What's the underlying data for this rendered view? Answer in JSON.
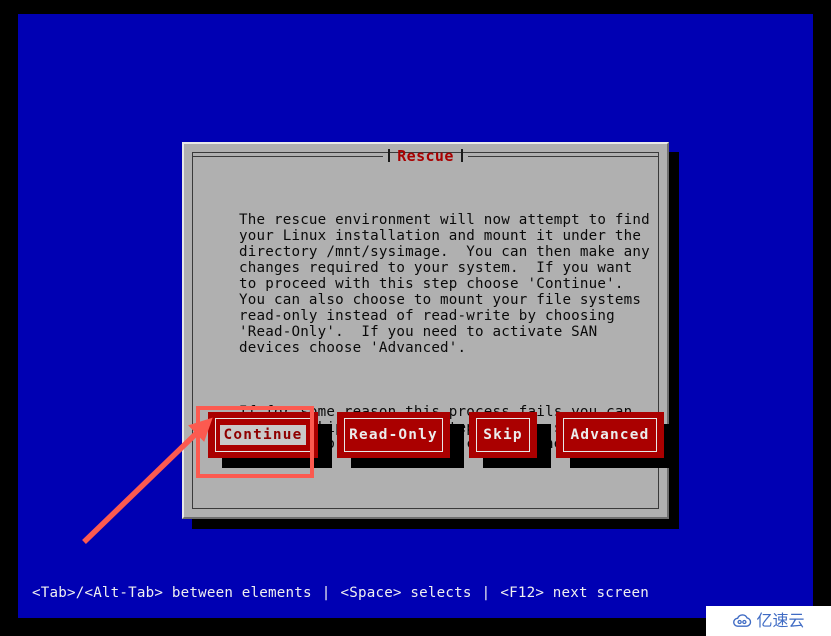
{
  "screen": {
    "background_color": "#0000b3",
    "frame_color": "#000000"
  },
  "dialog": {
    "title": "Rescue",
    "title_color": "#a80000",
    "background_color": "#b0b0b0",
    "paragraphs": [
      "The rescue environment will now attempt to find\nyour Linux installation and mount it under the\ndirectory /mnt/sysimage.  You can then make any\nchanges required to your system.  If you want\nto proceed with this step choose 'Continue'.\nYou can also choose to mount your file systems\nread-only instead of read-write by choosing\n'Read-Only'.  If you need to activate SAN\ndevices choose 'Advanced'.",
      "If for some reason this process fails you can\nchoose 'Skip' and this step will be skipped and\nyou will go directly to a command shell."
    ],
    "buttons": [
      {
        "label": "Continue",
        "selected": true
      },
      {
        "label": "Read-Only",
        "selected": false
      },
      {
        "label": "Skip",
        "selected": false
      },
      {
        "label": "Advanced",
        "selected": false
      }
    ],
    "button_color": "#aa0000",
    "button_text_color": "#ececec",
    "selected_label_bg": "#c9c9c9",
    "selected_label_color": "#8e0000"
  },
  "annotations": {
    "highlight_color": "#fc5a50",
    "highlight_target": "Continue",
    "arrow_color": "#fc5a50"
  },
  "statusbar": {
    "hint_tab": "<Tab>/<Alt-Tab> between elements",
    "separator_1": "|",
    "hint_space": "<Space> selects",
    "separator_2": "|",
    "hint_f12": "<F12> next screen",
    "text_color": "#f0f0f0"
  },
  "watermark": {
    "text": "亿速云",
    "icon": "cloud-icon",
    "color": "#3f6bc4"
  }
}
